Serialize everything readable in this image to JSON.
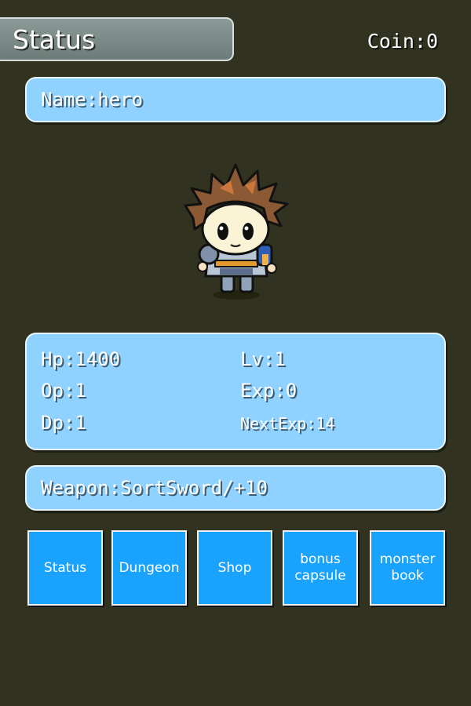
{
  "header": {
    "title": "Status",
    "coin": "Coin:0"
  },
  "name_panel": {
    "text": "Name:hero"
  },
  "stats": {
    "hp": "Hp:1400",
    "lv": "Lv:1",
    "op": "Op:1",
    "exp": "Exp:0",
    "dp": "Dp:1",
    "next_exp": "NextExp:14"
  },
  "weapon_panel": {
    "text": "Weapon:SortSword/+10"
  },
  "character": {
    "icon": "hero-sprite-icon"
  },
  "nav": [
    {
      "label": "Status"
    },
    {
      "label": "Dungeon"
    },
    {
      "label": "Shop"
    },
    {
      "label": "bonus capsule"
    },
    {
      "label": "monster book"
    }
  ],
  "colors": {
    "background": "#31321f",
    "panel": "#8fd1ff",
    "button": "#19a3ff"
  }
}
